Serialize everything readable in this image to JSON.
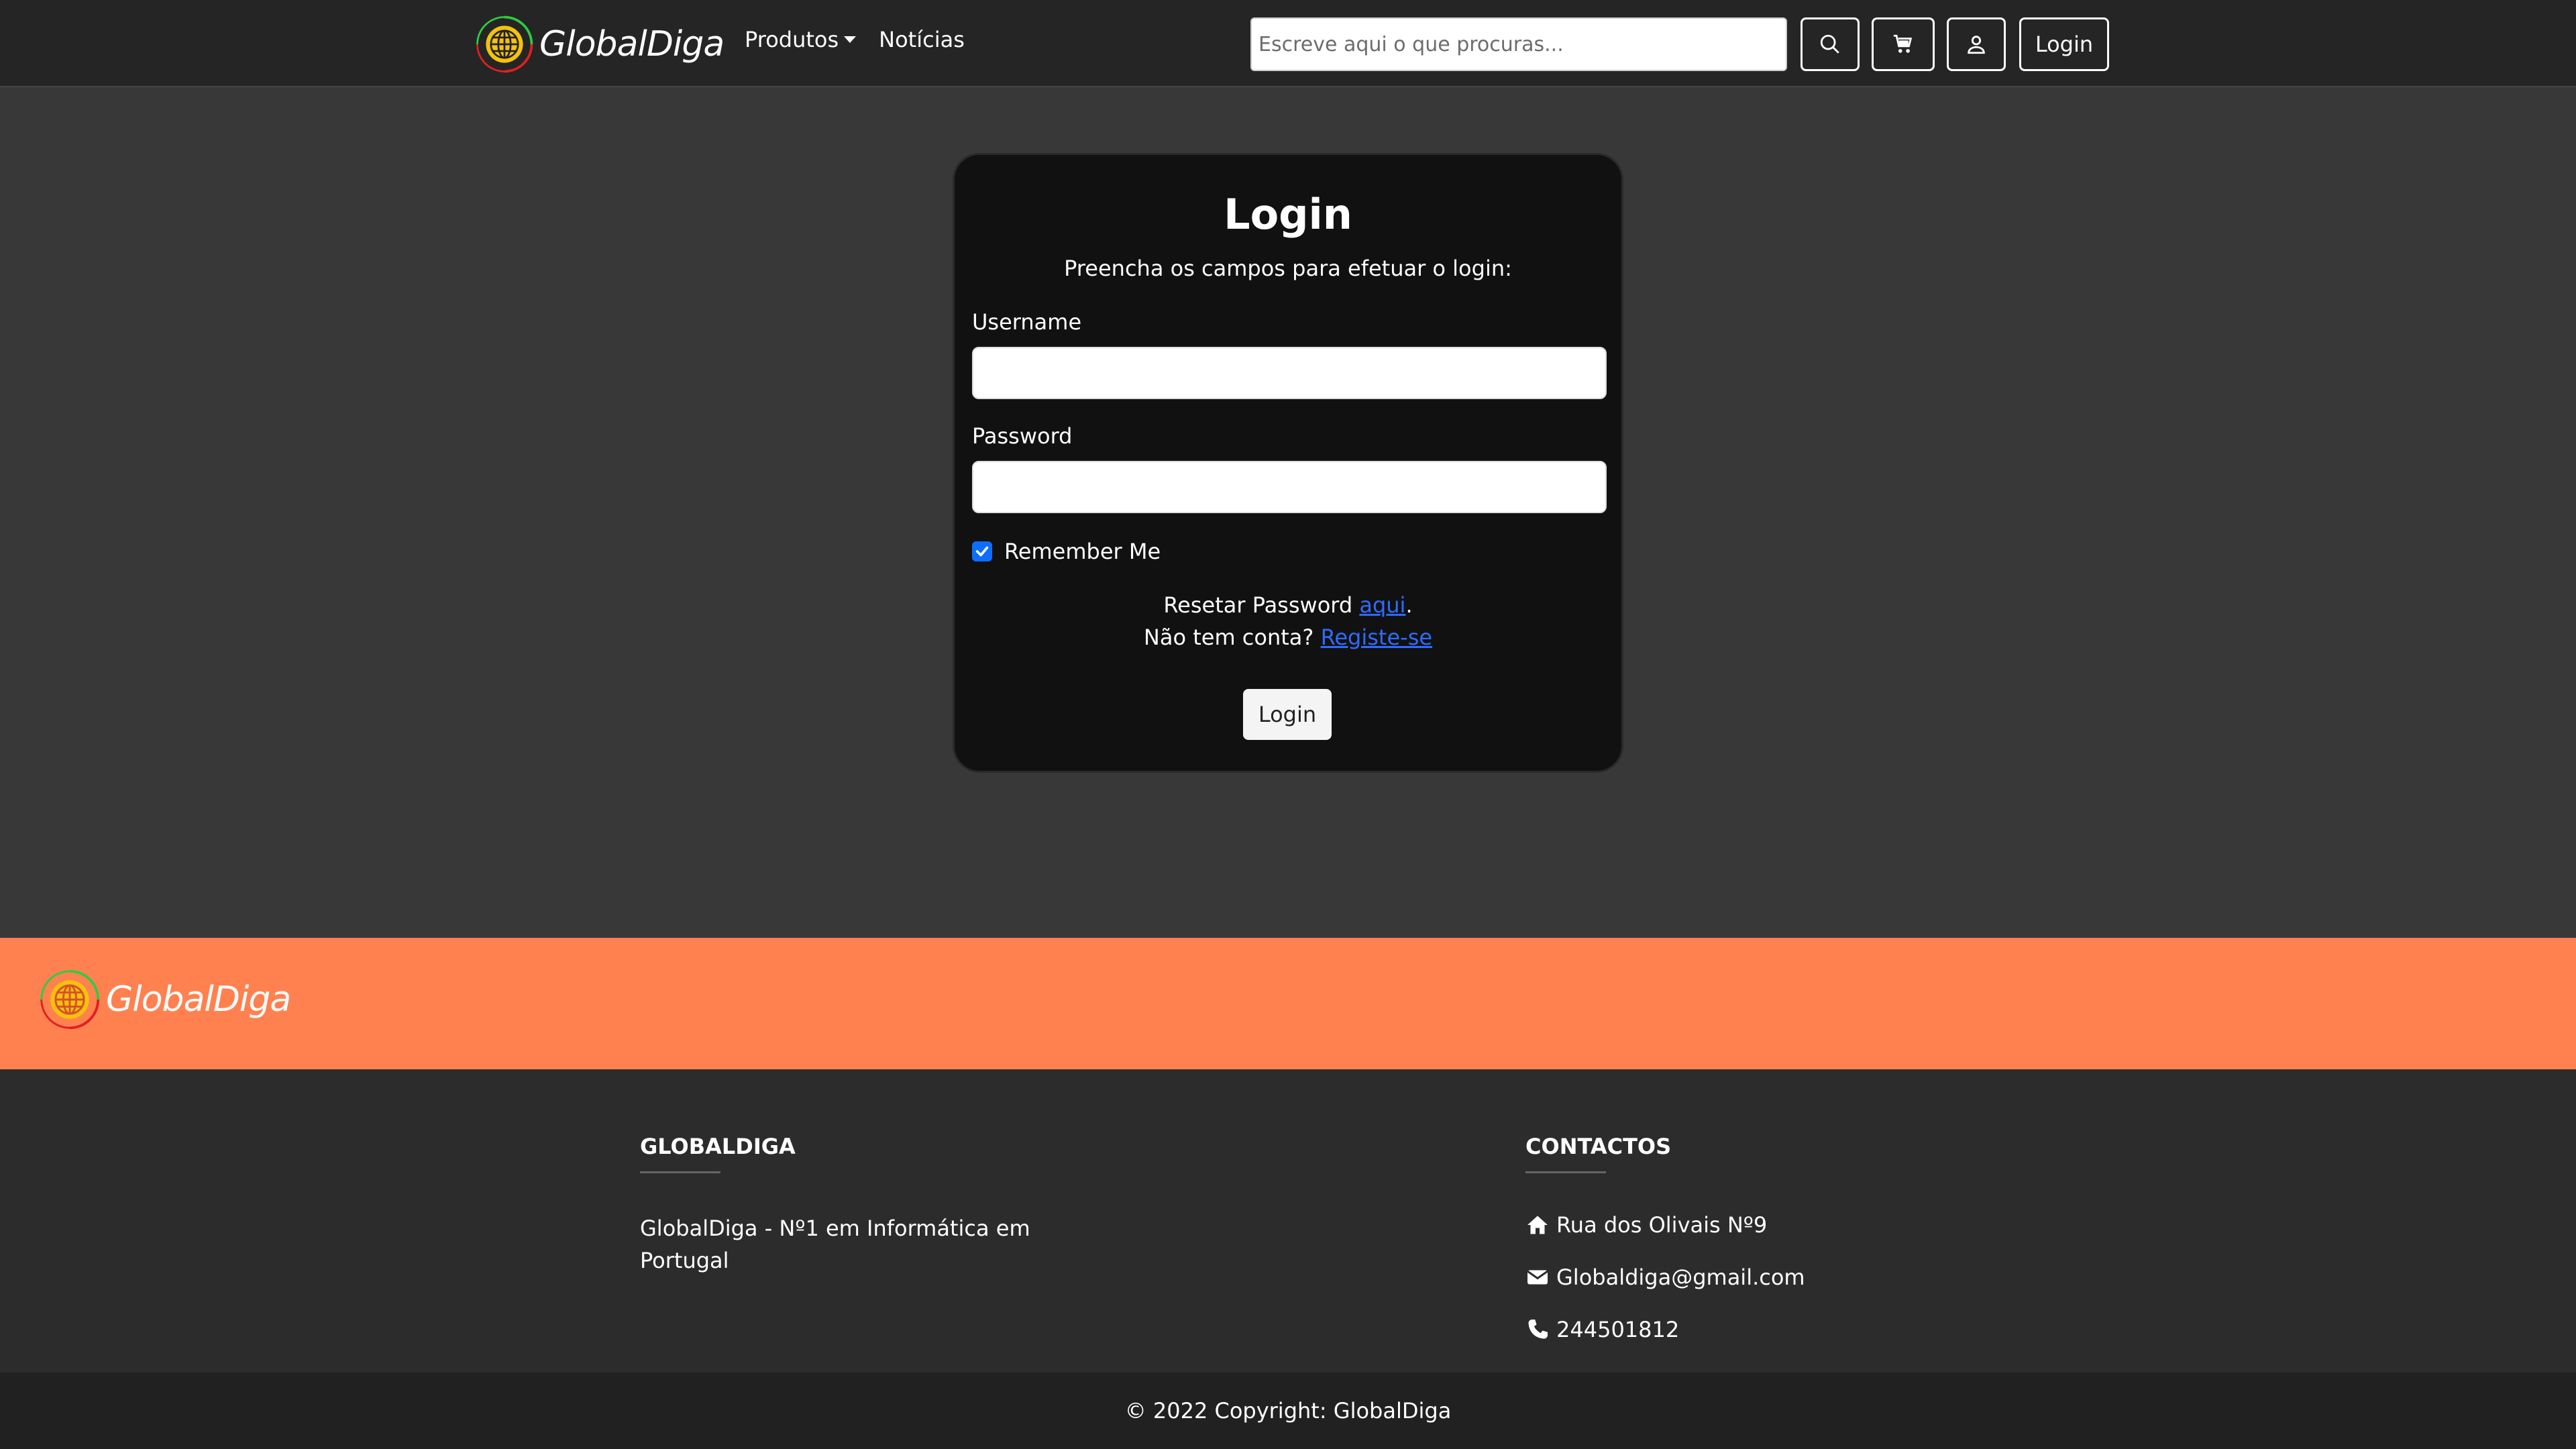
{
  "nav": {
    "brand": "GlobalDiga",
    "links": [
      "Produtos",
      "Notícias"
    ],
    "search_placeholder": "Escreve aqui o que procuras...",
    "login_label": "Login",
    "icons": [
      "search-icon",
      "cart-icon",
      "user-icon"
    ]
  },
  "login_card": {
    "title": "Login",
    "subtitle": "Preencha os campos para efetuar o login:",
    "username_label": "Username",
    "password_label": "Password",
    "remember_label": "Remember Me",
    "remember_checked": true,
    "reset_text": "Resetar Password ",
    "reset_link": "aqui",
    "reset_suffix": ".",
    "register_text": "Não tem conta? ",
    "register_link": "Registe-se",
    "submit_label": "Login"
  },
  "band": {
    "brand": "GlobalDiga"
  },
  "footer": {
    "col1_heading": "GLOBALDIGA",
    "col1_text": "GlobalDiga - Nº1 em Informática em Portugal",
    "col2_heading": "CONTACTOS",
    "address": "Rua dos Olivais Nº9",
    "email": "Globaldiga@gmail.com",
    "phone": "244501812",
    "copyright": "© 2022 Copyright: GlobalDiga"
  },
  "colors": {
    "navbar_bg": "#252525",
    "page_bg": "#383838",
    "card_bg": "#111111",
    "band_bg": "#ff8150",
    "footer_bg": "#2c2c2c",
    "copyright_bg": "#212121",
    "link": "#2f6bff",
    "checkbox": "#0d6efd"
  }
}
